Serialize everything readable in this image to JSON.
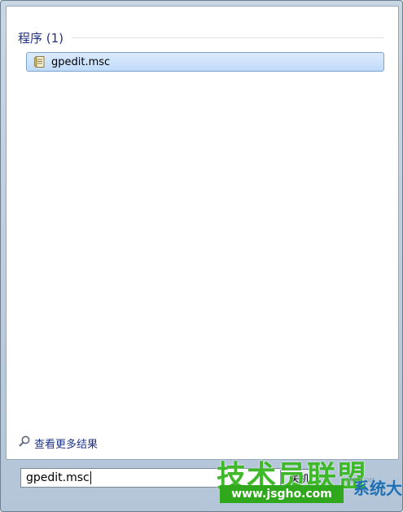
{
  "panel": {
    "group_title": "程序 (1)",
    "results": [
      {
        "label": "gpedit.msc",
        "icon": "policy-file-icon"
      }
    ],
    "more_results_label": "查看更多结果"
  },
  "search": {
    "value": "gpedit.msc"
  },
  "shutdown_button": {
    "label": "关机"
  },
  "watermark": {
    "main_text": "技术员联盟",
    "url_text": "www.jsgho.com",
    "side_text": "系统大全",
    "small_text": "P85.COM"
  },
  "colors": {
    "header_blue": "#1e3287",
    "selection_border": "#7da2ce",
    "watermark_green": "#3fb82a"
  }
}
